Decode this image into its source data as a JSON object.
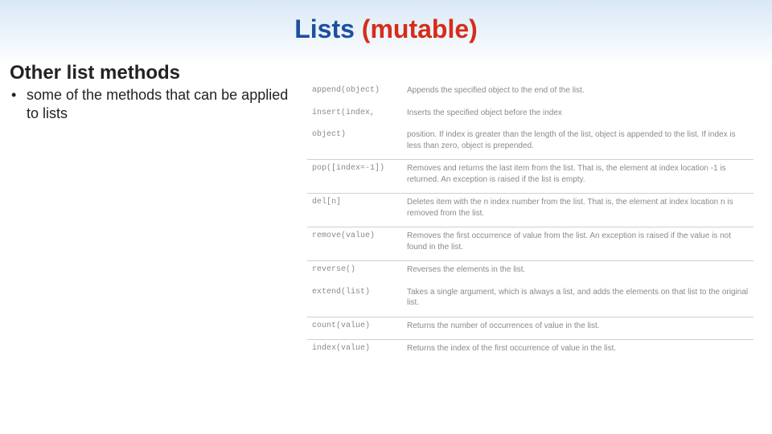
{
  "title": {
    "part1": "Lists ",
    "part2": "(mutable)"
  },
  "heading": "Other list methods",
  "bullet_text": "some of the methods that can be applied to lists",
  "methods": [
    {
      "sig": "append(object)",
      "desc": "Appends the specified object to the end of the list."
    },
    {
      "sig": "insert(index,",
      "desc": "Inserts the specified object before the index"
    },
    {
      "sig": "object)",
      "desc": "position. If index is greater than the length of the list, object is appended to the list. If index is less than zero, object is prepended."
    },
    {
      "sig": "pop([index=-1])",
      "desc": "Removes and returns the last item from the list. That is, the element at index location -1 is returned. An exception is raised if the list is empty."
    },
    {
      "sig": "del[n]",
      "desc": "Deletes item with the n index number from the list. That is, the element at index location n is removed from the list."
    },
    {
      "sig": "remove(value)",
      "desc": "Removes the first occurrence of value from the list. An exception is raised if the value is not found in the list."
    },
    {
      "sig": "reverse()",
      "desc": "Reverses the elements in the list."
    },
    {
      "sig": "extend(list)",
      "desc": "Takes a single argument, which is always a list, and adds the elements on that list to the original list."
    },
    {
      "sig": "count(value)",
      "desc": "Returns the number of occurrences of value in the list."
    },
    {
      "sig": "index(value)",
      "desc": "Returns the index of the first occurrence of value in the list."
    }
  ]
}
